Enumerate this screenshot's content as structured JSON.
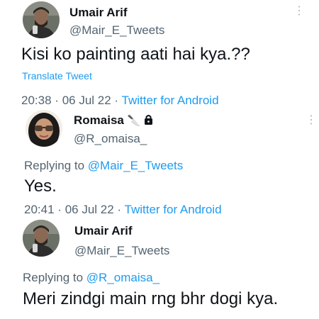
{
  "tweet1": {
    "author_name": "Umair Arif",
    "author_handle": "@Mair_E_Tweets",
    "text": "Kisi ko painting aati hai kya.??",
    "translate_label": "Translate Tweet",
    "time": "20:38",
    "date": "06 Jul 22",
    "source": "Twitter for Android",
    "separator": "·"
  },
  "tweet2": {
    "author_name": "Romaisa",
    "name_emojis": "🔪 🔒",
    "author_handle": "@R_omaisa_",
    "replying_label": "Replying to",
    "replying_to": "@Mair_E_Tweets",
    "text": "Yes.",
    "time": "20:41",
    "date": "06 Jul 22",
    "source": "Twitter for Android",
    "separator": "·"
  },
  "tweet3": {
    "author_name": "Umair Arif",
    "author_handle": "@Mair_E_Tweets",
    "replying_label": "Replying to",
    "replying_to": "@R_omaisa_",
    "text": "Meri zindgi main rng bhr dogi kya."
  },
  "icons": {
    "more": "more-options-icon",
    "lock": "lock-icon",
    "knife": "knife-emoji"
  },
  "colors": {
    "link": "#1d9bf0",
    "secondary": "#536471",
    "primary": "#0f1419"
  }
}
